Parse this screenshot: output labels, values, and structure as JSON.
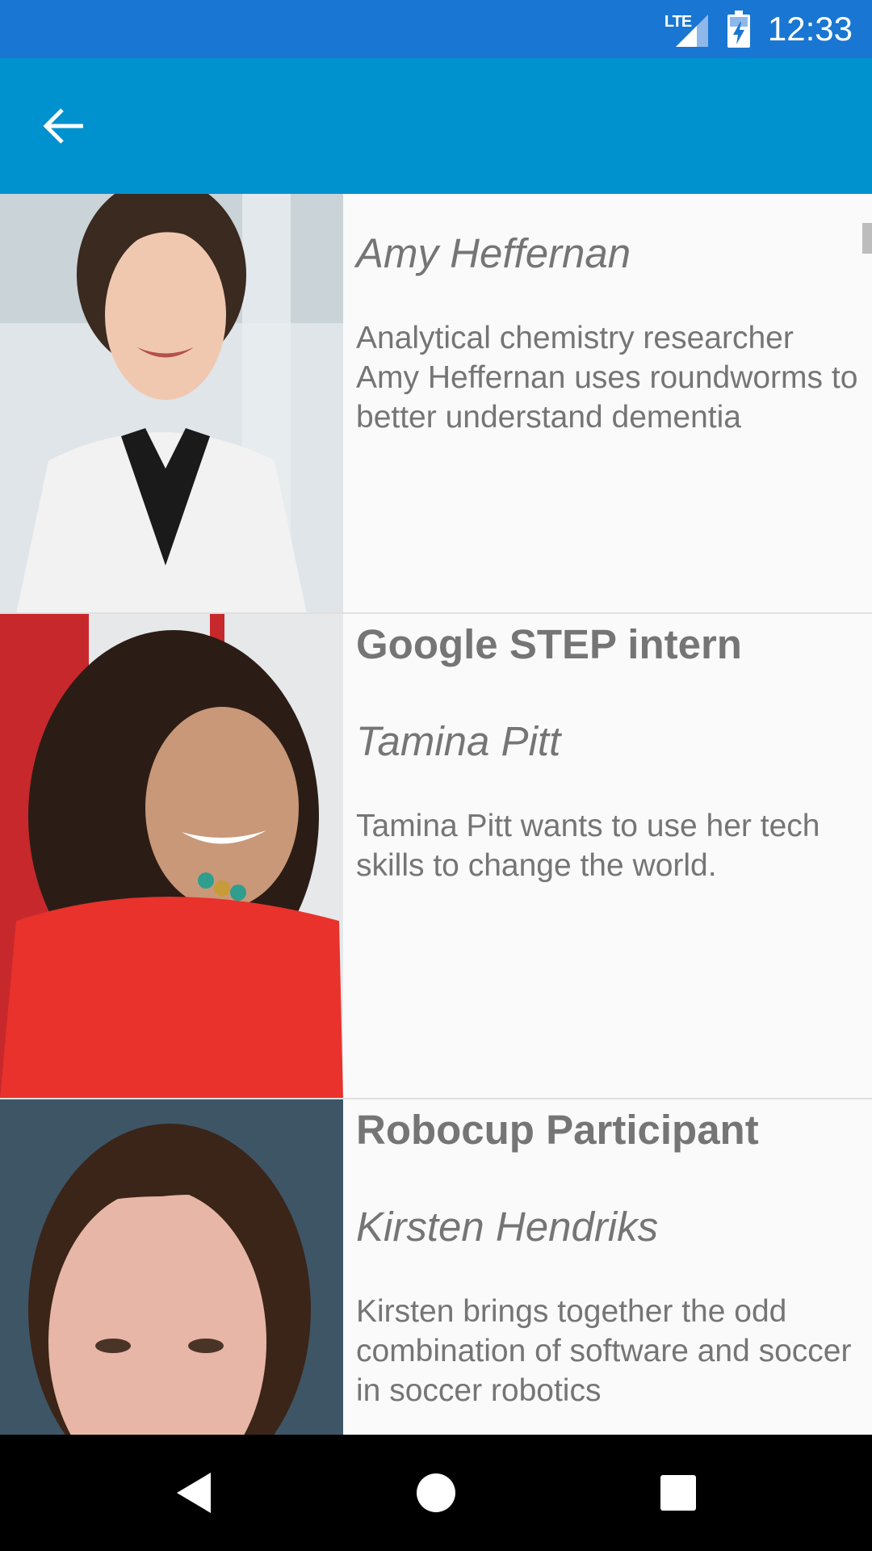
{
  "status_bar": {
    "network": "LTE",
    "time": "12:33",
    "icons": [
      "signal-icon",
      "battery-charging-icon"
    ]
  },
  "app_bar": {
    "back_icon": "arrow-back-icon"
  },
  "items": [
    {
      "category": "",
      "name": "Amy Heffernan",
      "description": "Analytical chemistry researcher Amy Heffernan uses roundworms to better understand dementia"
    },
    {
      "category": "Google STEP intern",
      "name": "Tamina Pitt",
      "description": "Tamina Pitt wants to use her tech skills to change the world."
    },
    {
      "category": "Robocup Participant",
      "name": "Kirsten Hendriks",
      "description": "Kirsten brings together the odd combination of software and soccer in soccer robotics"
    }
  ],
  "nav_bar": {
    "icons": [
      "back-triangle-icon",
      "home-circle-icon",
      "recents-square-icon"
    ]
  },
  "colors": {
    "status_bar": "#1976d2",
    "app_bar": "#0091cf",
    "text": "#757575",
    "background": "#fafafa"
  }
}
